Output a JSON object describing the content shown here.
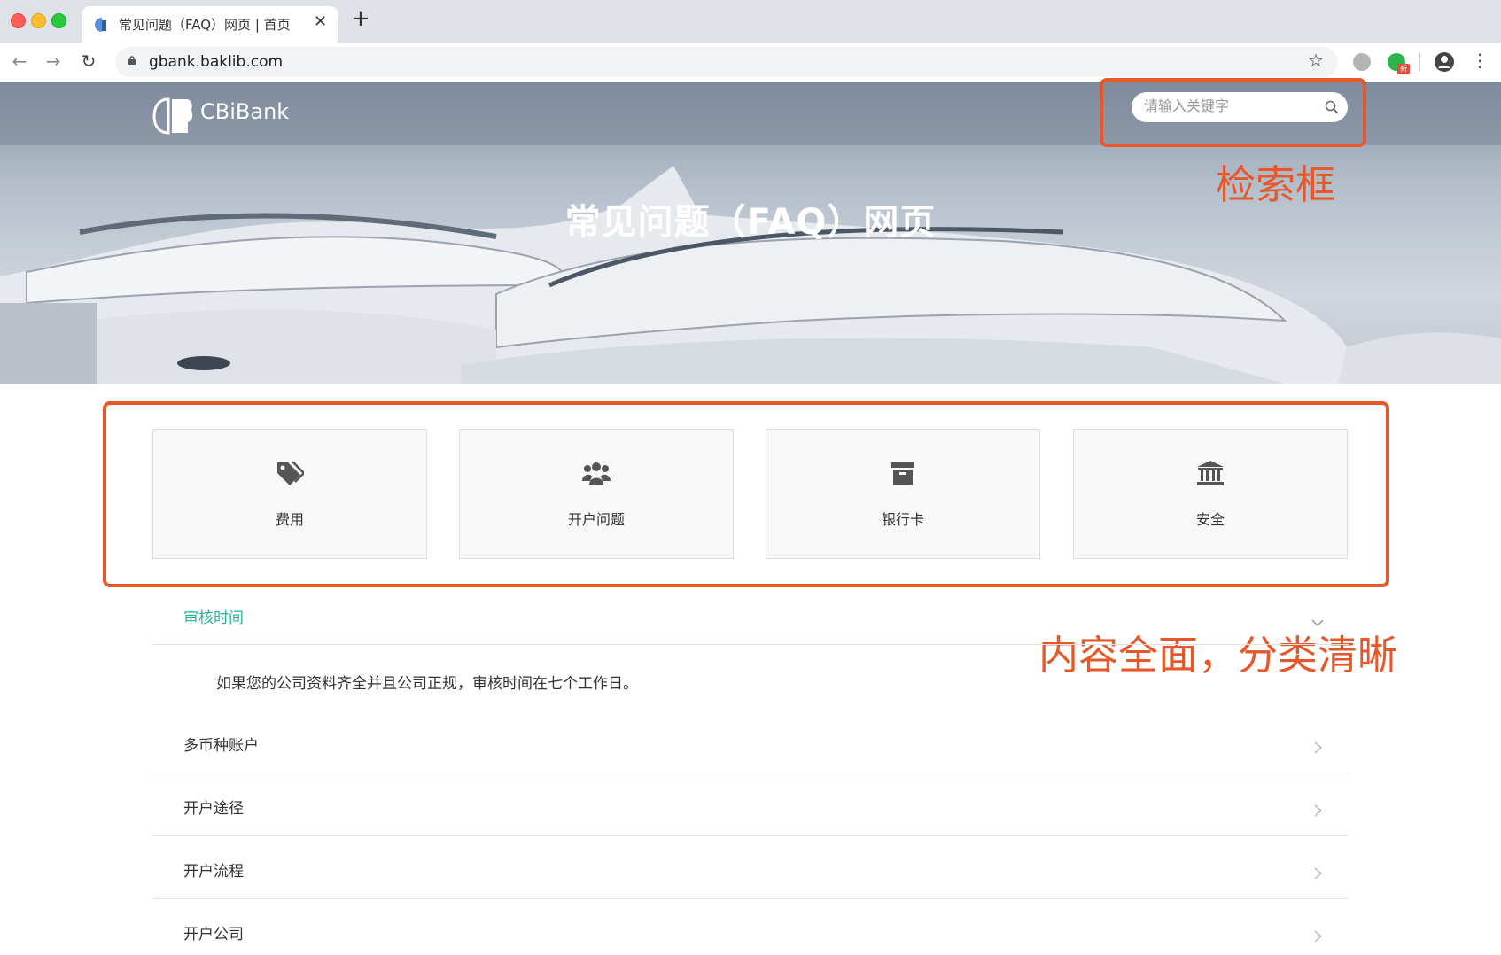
{
  "browser": {
    "tab_title": "常见问题（FAQ）网页 | 首页",
    "tab_close": "✕",
    "new_tab": "+",
    "url": "gbank.baklib.com",
    "ext_badge": "新"
  },
  "site": {
    "logo_text": "CBiBank",
    "search_placeholder": "请输入关键字",
    "hero_title": "常见问题（FAQ）网页"
  },
  "annotations": {
    "search_label": "检索框",
    "content_label": "内容全面，分类清晰",
    "color": "#e6572a"
  },
  "categories": [
    {
      "label": "费用",
      "icon": "tags-icon"
    },
    {
      "label": "开户问题",
      "icon": "users-icon"
    },
    {
      "label": "银行卡",
      "icon": "archive-icon"
    },
    {
      "label": "安全",
      "icon": "bank-icon"
    }
  ],
  "faq": {
    "expanded": {
      "title": "审核时间",
      "answer": "如果您的公司资料齐全并且公司正规，审核时间在七个工作日。"
    },
    "items": [
      "多币种账户",
      "开户途径",
      "开户流程",
      "开户公司"
    ]
  },
  "colors": {
    "accent_green": "#26b399",
    "annotation_red": "#e6572a"
  }
}
